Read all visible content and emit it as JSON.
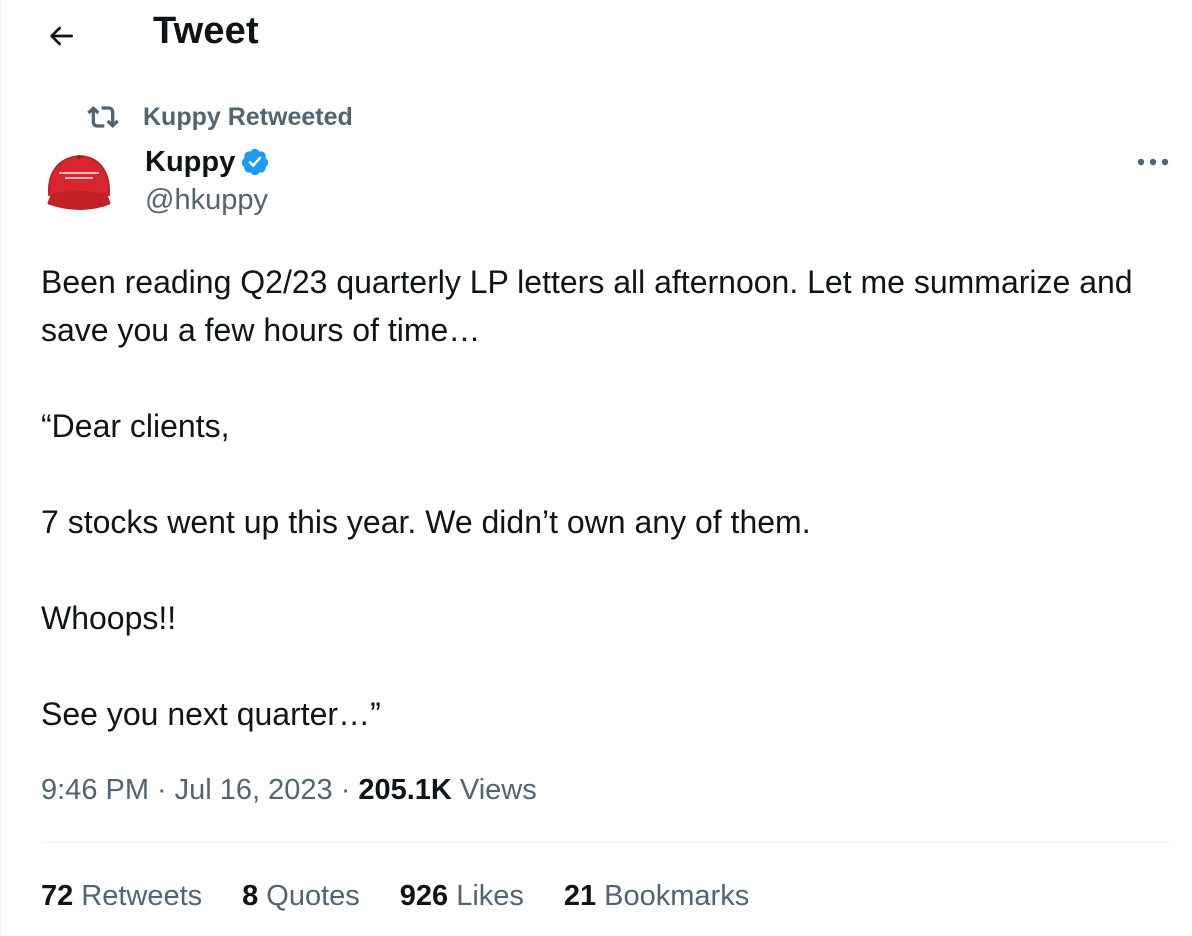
{
  "header": {
    "title": "Tweet",
    "back_icon": "arrow-left-icon"
  },
  "retweet_banner": {
    "icon": "retweet-icon",
    "text": "Kuppy Retweeted"
  },
  "author": {
    "display_name": "Kuppy",
    "handle": "@hkuppy",
    "verified": true,
    "verified_color": "#1d9bf0",
    "avatar": "red-cap-avatar"
  },
  "more_icon": "more-horizontal-icon",
  "tweet": {
    "paragraphs": [
      "Been reading Q2/23 quarterly LP letters all afternoon. Let me summarize and save you a few hours of time…",
      "“Dear clients,",
      "7 stocks went up this year. We didn’t own any of them.",
      "Whoops!!",
      "See you next quarter…”"
    ]
  },
  "meta": {
    "time": "9:46 PM",
    "separator": "·",
    "date": "Jul 16, 2023",
    "views_count": "205.1K",
    "views_label": "Views"
  },
  "stats": [
    {
      "count": "72",
      "label": "Retweets"
    },
    {
      "count": "8",
      "label": "Quotes"
    },
    {
      "count": "926",
      "label": "Likes"
    },
    {
      "count": "21",
      "label": "Bookmarks"
    }
  ],
  "colors": {
    "text_primary": "#0f1419",
    "text_secondary": "#536471",
    "accent": "#1d9bf0",
    "divider": "#eff3f4"
  }
}
